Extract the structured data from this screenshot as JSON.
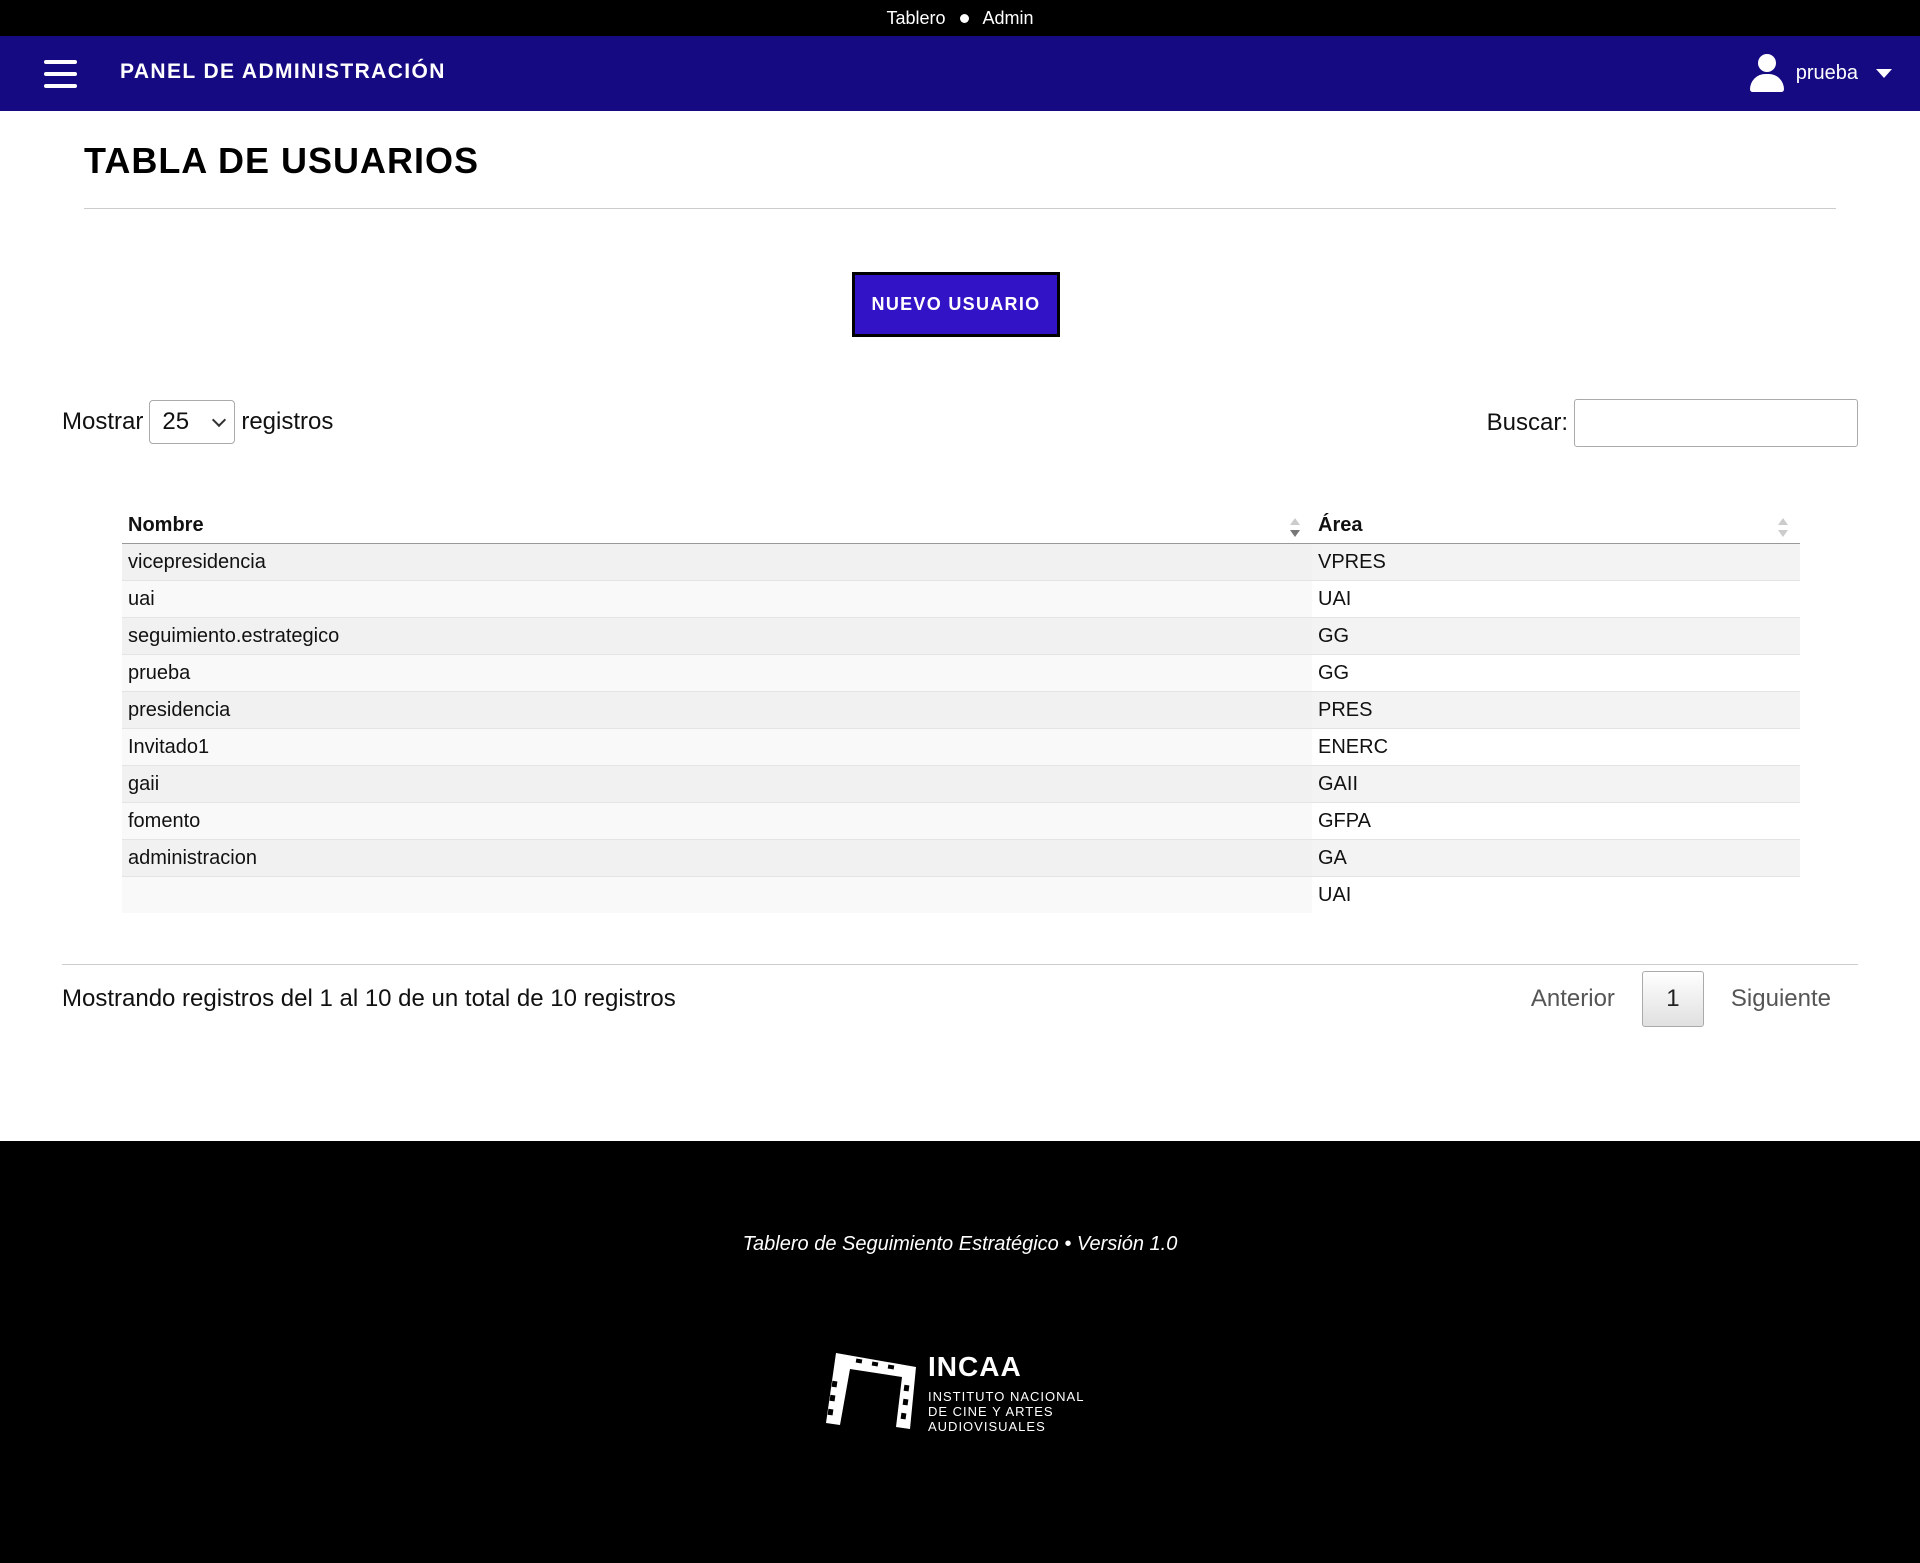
{
  "topbar": {
    "links": [
      "Tablero",
      "Admin"
    ]
  },
  "navbar": {
    "title": "PANEL DE ADMINISTRACIÓN",
    "user": "prueba"
  },
  "page": {
    "title": "TABLA DE USUARIOS",
    "new_button": "NUEVO USUARIO"
  },
  "controls": {
    "show_label": "Mostrar",
    "show_value": "25",
    "records_label": "registros",
    "search_label": "Buscar:",
    "search_value": ""
  },
  "table": {
    "columns": [
      "Nombre",
      "Área"
    ],
    "rows": [
      [
        "vicepresidencia",
        "VPRES"
      ],
      [
        "uai",
        "UAI"
      ],
      [
        "seguimiento.estrategico",
        "GG"
      ],
      [
        "prueba",
        "GG"
      ],
      [
        "presidencia",
        "PRES"
      ],
      [
        "Invitado1",
        "ENERC"
      ],
      [
        "gaii",
        "GAII"
      ],
      [
        "fomento",
        "GFPA"
      ],
      [
        "administracion",
        "GA"
      ],
      [
        "",
        "UAI"
      ]
    ]
  },
  "footer_info": {
    "summary": "Mostrando registros del 1 al 10 de un total de 10 registros",
    "prev": "Anterior",
    "page": "1",
    "next": "Siguiente"
  },
  "footer": {
    "text": "Tablero de Seguimiento Estratégico • Versión 1.0",
    "logo_word": "INCAA",
    "logo_sub": "INSTITUTO NACIONAL\nDE CINE Y ARTES\nAUDIOVISUALES"
  },
  "colors": {
    "navbar": "#160a82",
    "button": "#3313c6",
    "footer": "#000000"
  }
}
